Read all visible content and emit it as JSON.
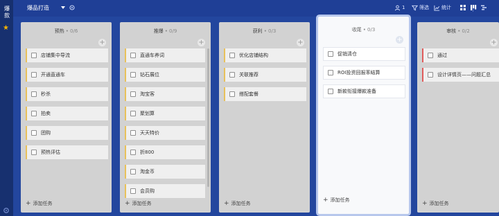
{
  "rail": {
    "tag": "爆款"
  },
  "topbar": {
    "board_title": "爆品打造",
    "members": "1",
    "filter_label": "筛选",
    "stats_label": "统计"
  },
  "columns": [
    {
      "title": "预热",
      "count": "• 0/6",
      "add_task": "添加任务",
      "cards": [
        "店铺集中导流",
        "开通直通车",
        "秒杀",
        "拍卖",
        "团购",
        "预热评估"
      ]
    },
    {
      "title": "推爆",
      "count": "• 0/9",
      "add_task": "添加任务",
      "cards": [
        "直通车养词",
        "钻石展位",
        "淘宝客",
        "聚划算",
        "天天特价",
        "折800",
        "淘金币",
        "会员购"
      ]
    },
    {
      "title": "获利",
      "count": "• 0/3",
      "add_task": "添加任务",
      "cards": [
        "优化店铺结构",
        "关联推荐",
        "搭配套餐"
      ]
    },
    {
      "title": "收尾",
      "count": "• 0/3",
      "add_task": "添加任务",
      "cards": [
        "促销清仓",
        "ROI投资回报率结算",
        "新款衔接爆款准备"
      ]
    },
    {
      "title": "审核",
      "count": "• 0/2",
      "add_task": "添加任务",
      "cards": [
        "通过",
        "设计详情页——问题汇总"
      ]
    }
  ],
  "colors": {
    "background": "#1c3d8f",
    "card_accent_yellow": "#e8c15a",
    "card_accent_red": "#e05b5b",
    "star": "#f5b300"
  }
}
